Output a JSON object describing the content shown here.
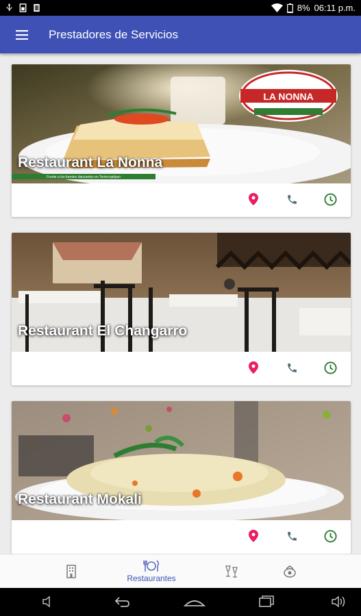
{
  "status_bar": {
    "battery": "8%",
    "time": "06:11 p.m."
  },
  "app_bar": {
    "title": "Prestadores de Servicios",
    "menu_icon": "hamburger-icon"
  },
  "cards": [
    {
      "title": "Restaurant La Nonna",
      "logo_text": "LA NONNA",
      "banner_text": "Frente a los fuentes danzantes en Teotocopilpan"
    },
    {
      "title": "Restaurant El Changarro"
    },
    {
      "title": "Restaurant Mokali"
    }
  ],
  "actions": {
    "location_icon": "location-pin-icon",
    "phone_icon": "phone-icon",
    "clock_icon": "clock-icon",
    "location_color": "#e91e63",
    "phone_color": "#546e7a",
    "clock_color": "#2e7d32"
  },
  "bottom_nav": {
    "items": [
      {
        "icon": "hotel-icon",
        "label": ""
      },
      {
        "icon": "restaurant-icon",
        "label": "Restaurantes"
      },
      {
        "icon": "bar-icon",
        "label": ""
      },
      {
        "icon": "tours-icon",
        "label": ""
      }
    ],
    "active_color": "#3f51b5"
  },
  "colors": {
    "primary": "#3f51b5",
    "background": "#ececec"
  }
}
